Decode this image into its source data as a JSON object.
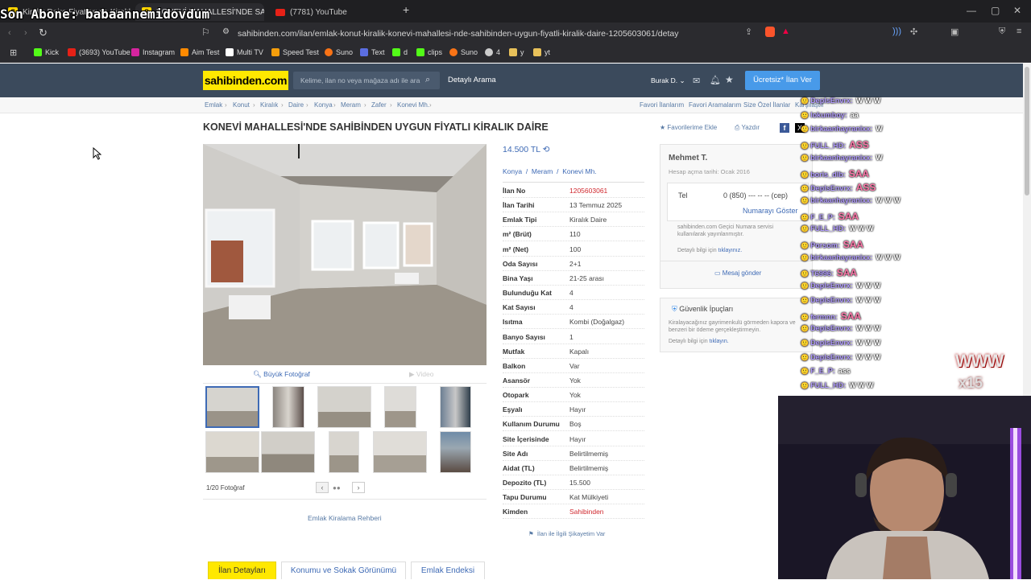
{
  "overlay": {
    "last_sub": "Son Abone: babaannemidovdum",
    "www": "WWW",
    "x15": "x15"
  },
  "browser": {
    "tabs": [
      {
        "label": "Kiralık Daire Fiyatları ve Kiralık Ev İlan"
      },
      {
        "label": "KONEVİ MAHALLESİ'NDE SAHİB..."
      },
      {
        "label": "(7781) YouTube"
      }
    ],
    "url": "sahibinden.com/ilan/emlak-konut-kiralik-konevi-mahallesi-nde-sahibinden-uygun-fiyatli-kiralik-daire-1205603061/detay",
    "bookmarks": [
      {
        "label": "Kick",
        "color": "#53fc18"
      },
      {
        "label": "(3693) YouTube",
        "color": "#e62117"
      },
      {
        "label": "Instagram",
        "color": "#d6249f"
      },
      {
        "label": "Aim Test",
        "color": "#ff8a00"
      },
      {
        "label": "Multi TV",
        "color": "#ffffff"
      },
      {
        "label": "Speed Test",
        "color": "#f59e0b"
      },
      {
        "label": "Suno",
        "color": "#f97316"
      },
      {
        "label": "Text",
        "color": "#5b6ee1"
      },
      {
        "label": "d",
        "color": "#53fc18"
      },
      {
        "label": "clips",
        "color": "#53fc18"
      },
      {
        "label": "Suno",
        "color": "#f97316"
      },
      {
        "label": "4",
        "color": "#cccccc"
      },
      {
        "label": "y",
        "color": "#e8c15a"
      },
      {
        "label": "yt",
        "color": "#e8c15a"
      }
    ]
  },
  "site": {
    "logo": "sahibinden.com",
    "search_placeholder": "Kelime, ilan no veya mağaza adı ile ara",
    "detailed_search": "Detaylı Arama",
    "user": "Burak D.",
    "post_ad": "Ücretsiz* İlan Ver",
    "breadcrumbs": [
      "Emlak",
      "Konut",
      "Kiralık",
      "Daire",
      "Konya",
      "Meram",
      "Zafer",
      "Konevi Mh."
    ],
    "top_links": [
      "Favori İlanlarım",
      "Favori Aramalarım",
      "Size Özel İlanlar",
      "Karşılaştır"
    ],
    "title": "KONEVİ MAHALLESİ'NDE SAHİBİNDEN UYGUN FİYATLI KİRALIK DAİRE",
    "add_fav": "Favorilerime Ekle",
    "print": "Yazdır",
    "big_photo": "Büyük Fotoğraf",
    "video": "Video",
    "photo_count": "1/20 Fotoğraf",
    "guide": "Emlak Kiralama Rehberi",
    "price": "14.500 TL",
    "location": [
      "Konya",
      "Meram",
      "Konevi Mh."
    ],
    "details": [
      {
        "k": "İlan No",
        "v": "1205603061",
        "red": true
      },
      {
        "k": "İlan Tarihi",
        "v": "13 Temmuz 2025"
      },
      {
        "k": "Emlak Tipi",
        "v": "Kiralık Daire"
      },
      {
        "k": "m² (Brüt)",
        "v": "110"
      },
      {
        "k": "m² (Net)",
        "v": "100"
      },
      {
        "k": "Oda Sayısı",
        "v": "2+1"
      },
      {
        "k": "Bina Yaşı",
        "v": "21-25 arası"
      },
      {
        "k": "Bulunduğu Kat",
        "v": "4"
      },
      {
        "k": "Kat Sayısı",
        "v": "4"
      },
      {
        "k": "Isıtma",
        "v": "Kombi (Doğalgaz)"
      },
      {
        "k": "Banyo Sayısı",
        "v": "1"
      },
      {
        "k": "Mutfak",
        "v": "Kapalı"
      },
      {
        "k": "Balkon",
        "v": "Var"
      },
      {
        "k": "Asansör",
        "v": "Yok"
      },
      {
        "k": "Otopark",
        "v": "Yok"
      },
      {
        "k": "Eşyalı",
        "v": "Hayır"
      },
      {
        "k": "Kullanım Durumu",
        "v": "Boş"
      },
      {
        "k": "Site İçerisinde",
        "v": "Hayır"
      },
      {
        "k": "Site Adı",
        "v": "Belirtilmemiş"
      },
      {
        "k": "Aidat (TL)",
        "v": "Belirtilmemiş"
      },
      {
        "k": "Depozito (TL)",
        "v": "15.500"
      },
      {
        "k": "Tapu Durumu",
        "v": "Kat Mülkiyeti"
      },
      {
        "k": "Kimden",
        "v": "Sahibinden",
        "red": true
      }
    ],
    "report": "İlan ile İlgili Şikayetim Var",
    "seller": {
      "name": "Mehmet T.",
      "since": "Hesap açma tarihi: Ocak 2016",
      "tel_label": "Tel",
      "tel": "0 (850) --- -- -- (cep)",
      "show_number": "Numarayı Göster",
      "note": "sahibinden.com Geçici Numara servisi kullanılarak yayınlanmıştır.",
      "detail": "Detaylı bilgi için",
      "click": "tıklayınız.",
      "message": "Mesaj gönder"
    },
    "safety": {
      "title": "Güvenlik İpuçları",
      "text": "Kiralayacağınız gayrimenkulü görmeden kapora ve benzeri bir ödeme gerçekleştirmeyin.",
      "detail": "Detaylı bilgi için",
      "click": "tıklayın."
    },
    "bottom_tabs": [
      "İlan Detayları",
      "Konumu ve Sokak Görünümü",
      "Emlak Endeksi"
    ]
  },
  "chat": [
    {
      "u": "DeplsEnvrx:",
      "m": "W W W"
    },
    {
      "u": "lokumboy:",
      "m": "aa"
    },
    {
      "u": "birkaanhayranixx:",
      "m": "W"
    },
    {
      "u": "FULL_HD:",
      "m": "ASS",
      "big": true
    },
    {
      "u": "birkaanhayranixx:",
      "m": "W"
    },
    {
      "u": "boris_dlb:",
      "m": "SAA",
      "big": true
    },
    {
      "u": "DeplsEnvrx:",
      "m": "ASS",
      "big": true
    },
    {
      "u": "birkaanhayranixx:",
      "m": "W W W"
    },
    {
      "u": "F_E_P:",
      "m": "SAA",
      "big": true
    },
    {
      "u": "FULL_HD:",
      "m": "W W W"
    },
    {
      "u": "Porsom:",
      "m": "SAA",
      "big": true
    },
    {
      "u": "birkaanhayranixx:",
      "m": "W W W"
    },
    {
      "u": "T6996:",
      "m": "SAA",
      "big": true
    },
    {
      "u": "DeplsEnvrx:",
      "m": "W W W"
    },
    {
      "u": "DeplsEnvrx:",
      "m": "W W W"
    },
    {
      "u": "fermnn:",
      "m": "SAA",
      "big": true
    },
    {
      "u": "DeplsEnvrx:",
      "m": "W W W"
    },
    {
      "u": "DeplsEnvrx:",
      "m": "W W W"
    },
    {
      "u": "DeplsEnvrx:",
      "m": "W W W"
    },
    {
      "u": "F_E_P:",
      "m": "ass"
    },
    {
      "u": "FULL_HD:",
      "m": "W W W"
    }
  ]
}
